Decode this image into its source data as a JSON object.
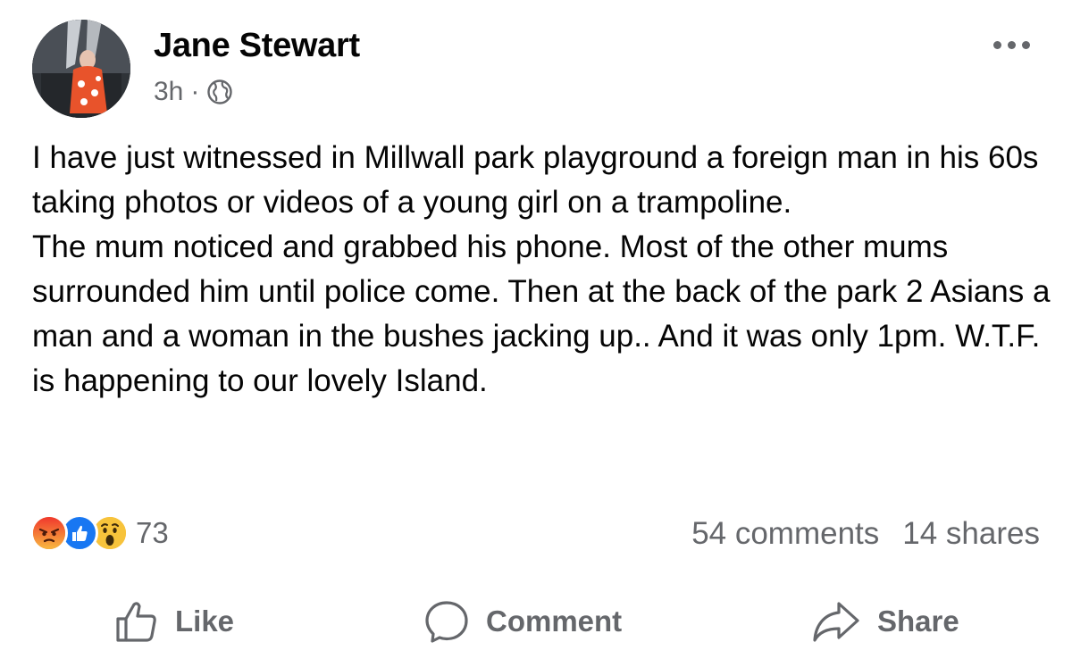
{
  "post": {
    "author": "Jane Stewart",
    "time": "3h",
    "separator": "·",
    "privacy_icon": "globe-icon",
    "paragraphs": [
      "I have just witnessed in Millwall park playground a foreign man in his 60s taking photos or videos of a young girl on a trampoline.",
      "The mum noticed and grabbed his phone. Most of the other mums surrounded him until police come. Then at the back of the park 2 Asians a man and a woman in the bushes jacking up.. And it was only 1pm. W.T.F. is happening to our lovely Island."
    ]
  },
  "stats": {
    "reaction_icons": [
      "angry-reaction-icon",
      "like-reaction-icon",
      "wow-reaction-icon"
    ],
    "reaction_count": "73",
    "comments": "54 comments",
    "shares": "14 shares"
  },
  "actions": {
    "like_label": "Like",
    "comment_label": "Comment",
    "share_label": "Share"
  },
  "colors": {
    "text": "#050505",
    "secondary": "#65676b",
    "like_blue": "#1877f2",
    "angry": "#e9710f",
    "wow": "#f7b125"
  }
}
